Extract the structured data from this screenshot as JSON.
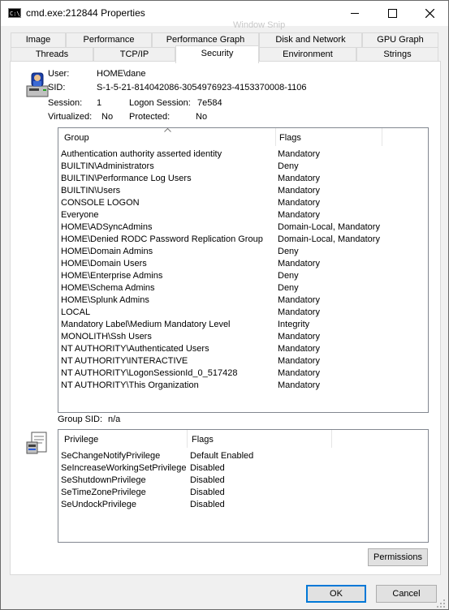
{
  "window": {
    "title": "cmd.exe:212844 Properties",
    "app_icon_text": "C:\\_",
    "ghost_text": "Window Snip"
  },
  "tabs_row1": [
    "Image",
    "Performance",
    "Performance Graph",
    "Disk and Network",
    "GPU Graph"
  ],
  "tabs_row2": [
    "Threads",
    "TCP/IP",
    "Security",
    "Environment",
    "Strings"
  ],
  "active_tab": "Security",
  "info": {
    "user_label": "User:",
    "user": "HOME\\dane",
    "sid_label": "SID:",
    "sid": "S-1-5-21-814042086-3054976923-4153370008-1106",
    "session_label": "Session:",
    "session": "1",
    "logon_label": "Logon Session:",
    "logon": "7e584",
    "virtualized_label": "Virtualized:",
    "virtualized": "No",
    "protected_label": "Protected:",
    "protected": "No"
  },
  "groups": {
    "col_group": "Group",
    "col_flags": "Flags",
    "rows": [
      [
        "Authentication authority asserted identity",
        "Mandatory"
      ],
      [
        "BUILTIN\\Administrators",
        "Deny"
      ],
      [
        "BUILTIN\\Performance Log Users",
        "Mandatory"
      ],
      [
        "BUILTIN\\Users",
        "Mandatory"
      ],
      [
        "CONSOLE LOGON",
        "Mandatory"
      ],
      [
        "Everyone",
        "Mandatory"
      ],
      [
        "HOME\\ADSyncAdmins",
        "Domain-Local, Mandatory"
      ],
      [
        "HOME\\Denied RODC Password Replication Group",
        "Domain-Local, Mandatory"
      ],
      [
        "HOME\\Domain Admins",
        "Deny"
      ],
      [
        "HOME\\Domain Users",
        "Mandatory"
      ],
      [
        "HOME\\Enterprise Admins",
        "Deny"
      ],
      [
        "HOME\\Schema Admins",
        "Deny"
      ],
      [
        "HOME\\Splunk Admins",
        "Mandatory"
      ],
      [
        "LOCAL",
        "Mandatory"
      ],
      [
        "Mandatory Label\\Medium Mandatory Level",
        "Integrity"
      ],
      [
        "MONOLITH\\Ssh Users",
        "Mandatory"
      ],
      [
        "NT AUTHORITY\\Authenticated Users",
        "Mandatory"
      ],
      [
        "NT AUTHORITY\\INTERACTIVE",
        "Mandatory"
      ],
      [
        "NT AUTHORITY\\LogonSessionId_0_517428",
        "Mandatory"
      ],
      [
        "NT AUTHORITY\\This Organization",
        "Mandatory"
      ]
    ]
  },
  "group_sid_label": "Group SID:",
  "group_sid": "n/a",
  "privileges": {
    "col_privilege": "Privilege",
    "col_flags": "Flags",
    "rows": [
      [
        "SeChangeNotifyPrivilege",
        "Default Enabled"
      ],
      [
        "SeIncreaseWorkingSetPrivilege",
        "Disabled"
      ],
      [
        "SeShutdownPrivilege",
        "Disabled"
      ],
      [
        "SeTimeZonePrivilege",
        "Disabled"
      ],
      [
        "SeUndockPrivilege",
        "Disabled"
      ]
    ]
  },
  "buttons": {
    "permissions": "Permissions",
    "ok": "OK",
    "cancel": "Cancel"
  },
  "icons": {
    "minimize": "minimize-icon",
    "maximize": "maximize-icon",
    "close": "close-icon",
    "user": "user-computer-icon",
    "privilege": "privilege-icon"
  },
  "colors": {
    "accent": "#0078d7",
    "window_border": "#6a6a6a",
    "button_face": "#e1e1e1"
  }
}
